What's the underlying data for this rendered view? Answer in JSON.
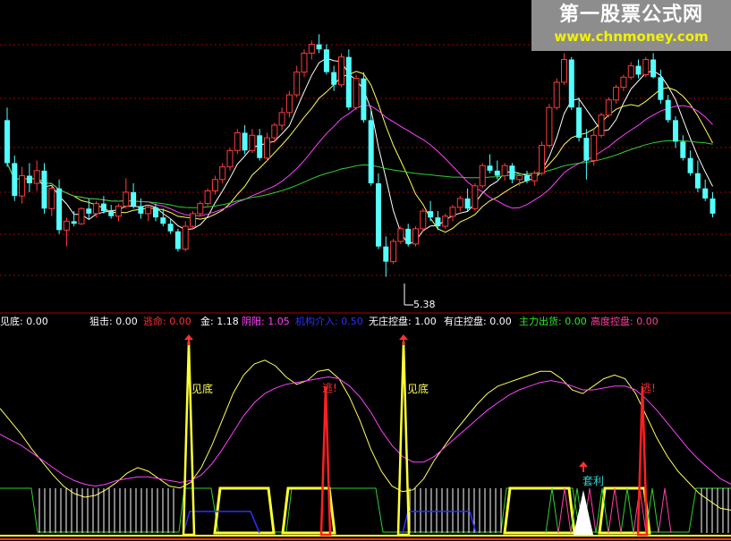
{
  "watermark": {
    "title": "第一股票公式网",
    "url": "www.chnmoney.com"
  },
  "indicator_legend": [
    {
      "label": "见底",
      "value": "0.00",
      "color": "#ffffff"
    },
    {
      "label": "狙击",
      "value": "0.00",
      "color": "#ffffff"
    },
    {
      "label": "逃命",
      "value": "0.00",
      "color": "#ff3030"
    },
    {
      "label": "金",
      "value": "1.18",
      "color": "#ffffff"
    },
    {
      "label": "阴阳",
      "value": "1.05",
      "color": "#ff40ff"
    },
    {
      "label": "机构介入",
      "value": "0.50",
      "color": "#3030ff"
    },
    {
      "label": "无庄控盘",
      "value": "1.00",
      "color": "#ffffff"
    },
    {
      "label": "有庄控盘",
      "value": "0.00",
      "color": "#ffffff"
    },
    {
      "label": "主力出货",
      "value": "0.00",
      "color": "#22ee22"
    },
    {
      "label": "高度控盘",
      "value": "0.00",
      "color": "#ff40a0"
    }
  ],
  "chart_data": [
    {
      "type": "candlestick",
      "low_annotation": "5.38",
      "colors": {
        "up": "#ff3c3c",
        "down": "#54ffff",
        "ma_white": "#ffffff",
        "ma_yellow": "#ffff55",
        "ma_purple": "#ff40ff",
        "ma_green": "#30d030"
      },
      "grid": true,
      "candles": [
        [
          6.62,
          6.72,
          6.25,
          6.28
        ],
        [
          6.28,
          6.34,
          5.98,
          6.02
        ],
        [
          6.02,
          6.25,
          5.96,
          6.18
        ],
        [
          6.18,
          6.28,
          6.05,
          6.12
        ],
        [
          6.12,
          6.3,
          6.06,
          6.22
        ],
        [
          6.22,
          6.28,
          5.88,
          5.92
        ],
        [
          5.92,
          6.1,
          5.86,
          6.08
        ],
        [
          6.08,
          6.15,
          5.72,
          5.75
        ],
        [
          5.75,
          5.85,
          5.62,
          5.82
        ],
        [
          5.82,
          5.9,
          5.78,
          5.8
        ],
        [
          5.8,
          5.93,
          5.79,
          5.92
        ],
        [
          5.92,
          6.0,
          5.84,
          5.88
        ],
        [
          5.88,
          5.98,
          5.85,
          5.96
        ],
        [
          5.96,
          6.02,
          5.88,
          5.9
        ],
        [
          5.9,
          5.95,
          5.84,
          5.86
        ],
        [
          5.86,
          5.96,
          5.82,
          5.94
        ],
        [
          5.94,
          6.16,
          5.92,
          6.05
        ],
        [
          6.05,
          6.12,
          5.92,
          5.94
        ],
        [
          5.94,
          6.0,
          5.84,
          5.88
        ],
        [
          5.88,
          5.95,
          5.82,
          5.93
        ],
        [
          5.93,
          5.96,
          5.82,
          5.85
        ],
        [
          5.85,
          5.92,
          5.78,
          5.8
        ],
        [
          5.8,
          5.84,
          5.72,
          5.74
        ],
        [
          5.74,
          5.76,
          5.58,
          5.6
        ],
        [
          5.6,
          5.82,
          5.58,
          5.78
        ],
        [
          5.78,
          5.9,
          5.76,
          5.88
        ],
        [
          5.88,
          5.98,
          5.86,
          5.96
        ],
        [
          5.96,
          6.08,
          5.94,
          6.06
        ],
        [
          6.06,
          6.18,
          6.03,
          6.15
        ],
        [
          6.15,
          6.28,
          6.12,
          6.25
        ],
        [
          6.25,
          6.4,
          6.22,
          6.38
        ],
        [
          6.38,
          6.55,
          6.35,
          6.52
        ],
        [
          6.52,
          6.58,
          6.35,
          6.38
        ],
        [
          6.38,
          6.55,
          6.36,
          6.5
        ],
        [
          6.5,
          6.55,
          6.3,
          6.32
        ],
        [
          6.32,
          6.52,
          6.3,
          6.48
        ],
        [
          6.48,
          6.6,
          6.44,
          6.58
        ],
        [
          6.58,
          6.72,
          6.54,
          6.68
        ],
        [
          6.68,
          6.85,
          6.64,
          6.82
        ],
        [
          6.82,
          7.05,
          6.8,
          7.0
        ],
        [
          7.0,
          7.18,
          6.96,
          7.15
        ],
        [
          7.15,
          7.25,
          7.1,
          7.22
        ],
        [
          7.22,
          7.3,
          7.15,
          7.18
        ],
        [
          7.18,
          7.22,
          6.98,
          7.0
        ],
        [
          7.0,
          7.05,
          6.85,
          6.9
        ],
        [
          6.9,
          7.15,
          6.88,
          7.12
        ],
        [
          7.12,
          7.18,
          6.7,
          6.72
        ],
        [
          6.72,
          6.98,
          6.7,
          6.95
        ],
        [
          6.95,
          7.0,
          6.6,
          6.62
        ],
        [
          6.62,
          6.7,
          6.1,
          6.12
        ],
        [
          6.12,
          6.2,
          5.6,
          5.62
        ],
        [
          5.62,
          5.7,
          5.38,
          5.5
        ],
        [
          5.5,
          5.68,
          5.48,
          5.66
        ],
        [
          5.66,
          5.78,
          5.64,
          5.76
        ],
        [
          5.76,
          5.8,
          5.62,
          5.64
        ],
        [
          5.64,
          5.78,
          5.62,
          5.76
        ],
        [
          5.76,
          5.92,
          5.74,
          5.9
        ],
        [
          5.9,
          5.98,
          5.82,
          5.85
        ],
        [
          5.85,
          5.9,
          5.75,
          5.78
        ],
        [
          5.78,
          5.88,
          5.76,
          5.86
        ],
        [
          5.86,
          5.95,
          5.82,
          5.93
        ],
        [
          5.93,
          6.02,
          5.9,
          6.0
        ],
        [
          6.0,
          6.08,
          5.9,
          5.92
        ],
        [
          5.92,
          6.12,
          5.9,
          6.1
        ],
        [
          6.1,
          6.28,
          6.08,
          6.26
        ],
        [
          6.26,
          6.35,
          6.2,
          6.22
        ],
        [
          6.22,
          6.3,
          6.15,
          6.18
        ],
        [
          6.18,
          6.28,
          6.14,
          6.26
        ],
        [
          6.26,
          6.28,
          6.12,
          6.15
        ],
        [
          6.15,
          6.2,
          6.1,
          6.18
        ],
        [
          6.18,
          6.22,
          6.12,
          6.14
        ],
        [
          6.14,
          6.22,
          6.1,
          6.2
        ],
        [
          6.2,
          6.45,
          6.18,
          6.42
        ],
        [
          6.42,
          6.75,
          6.4,
          6.72
        ],
        [
          6.72,
          6.95,
          6.7,
          6.92
        ],
        [
          6.92,
          7.15,
          6.9,
          7.1
        ],
        [
          7.1,
          7.12,
          6.7,
          6.72
        ],
        [
          6.72,
          6.8,
          6.45,
          6.48
        ],
        [
          6.48,
          6.55,
          6.15,
          6.3
        ],
        [
          6.3,
          6.55,
          6.26,
          6.5
        ],
        [
          6.5,
          6.68,
          6.48,
          6.66
        ],
        [
          6.66,
          6.8,
          6.64,
          6.78
        ],
        [
          6.78,
          6.9,
          6.75,
          6.88
        ],
        [
          6.88,
          6.98,
          6.85,
          6.96
        ],
        [
          6.96,
          7.08,
          6.94,
          7.05
        ],
        [
          7.05,
          7.1,
          6.95,
          6.98
        ],
        [
          6.98,
          7.12,
          6.96,
          7.1
        ],
        [
          7.1,
          7.15,
          6.95,
          6.96
        ],
        [
          6.96,
          7.02,
          6.75,
          6.78
        ],
        [
          6.78,
          6.82,
          6.6,
          6.62
        ],
        [
          6.62,
          6.65,
          6.4,
          6.45
        ],
        [
          6.45,
          6.5,
          6.3,
          6.32
        ],
        [
          6.32,
          6.38,
          6.18,
          6.2
        ],
        [
          6.2,
          6.3,
          6.05,
          6.08
        ],
        [
          6.08,
          6.15,
          5.98,
          6.0
        ],
        [
          6.0,
          6.05,
          5.85,
          5.88
        ]
      ]
    },
    {
      "type": "line",
      "series": [
        {
          "color": "#ffff55",
          "values": [
            0.62,
            0.55,
            0.48,
            0.4,
            0.33,
            0.26,
            0.2,
            0.16,
            0.14,
            0.15,
            0.18,
            0.22,
            0.27,
            0.3,
            0.28,
            0.24,
            0.2,
            0.19,
            0.22,
            0.3,
            0.42,
            0.56,
            0.7,
            0.8,
            0.86,
            0.88,
            0.85,
            0.79,
            0.75,
            0.77,
            0.82,
            0.83,
            0.78,
            0.68,
            0.55,
            0.4,
            0.28,
            0.2,
            0.17,
            0.18,
            0.24,
            0.34,
            0.42,
            0.5,
            0.57,
            0.64,
            0.7,
            0.74,
            0.76,
            0.78,
            0.8,
            0.82,
            0.82,
            0.78,
            0.72,
            0.7,
            0.74,
            0.78,
            0.8,
            0.78,
            0.7,
            0.58,
            0.46,
            0.36,
            0.28,
            0.22,
            0.16,
            0.12,
            0.08,
            0.07
          ]
        },
        {
          "color": "#ff40ff",
          "values": [
            0.48,
            0.45,
            0.42,
            0.38,
            0.34,
            0.3,
            0.26,
            0.23,
            0.21,
            0.2,
            0.21,
            0.23,
            0.24,
            0.25,
            0.25,
            0.24,
            0.23,
            0.22,
            0.23,
            0.26,
            0.32,
            0.4,
            0.49,
            0.58,
            0.65,
            0.7,
            0.73,
            0.75,
            0.76,
            0.77,
            0.78,
            0.79,
            0.78,
            0.74,
            0.68,
            0.6,
            0.5,
            0.42,
            0.36,
            0.33,
            0.33,
            0.36,
            0.41,
            0.46,
            0.51,
            0.56,
            0.61,
            0.65,
            0.69,
            0.72,
            0.74,
            0.76,
            0.77,
            0.76,
            0.74,
            0.72,
            0.72,
            0.73,
            0.74,
            0.74,
            0.72,
            0.67,
            0.61,
            0.54,
            0.47,
            0.4,
            0.34,
            0.29,
            0.24,
            0.21
          ]
        }
      ],
      "signal_labels": [
        "见底",
        "逃!",
        "见底",
        "逃!",
        "套利"
      ]
    }
  ]
}
